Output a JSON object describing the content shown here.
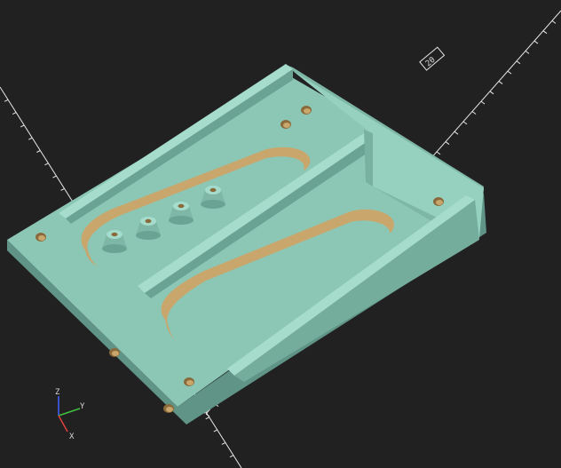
{
  "viewport": {
    "background": "#212121",
    "model_color": "#8cc7b6",
    "cut_color": "#c9a66b",
    "grid_color": "#e8e8e8"
  },
  "axes": {
    "tick_label_x": "20",
    "tick_label_y": "20",
    "gizmo": {
      "x_label": "X",
      "y_label": "Y",
      "z_label": "Z",
      "x_color": "#e04040",
      "y_color": "#40c040",
      "z_color": "#4060ff"
    }
  },
  "model": {
    "name_icon": "3d-bracket-model",
    "standoffs": 4,
    "mount_holes": 6,
    "slots": 2
  }
}
